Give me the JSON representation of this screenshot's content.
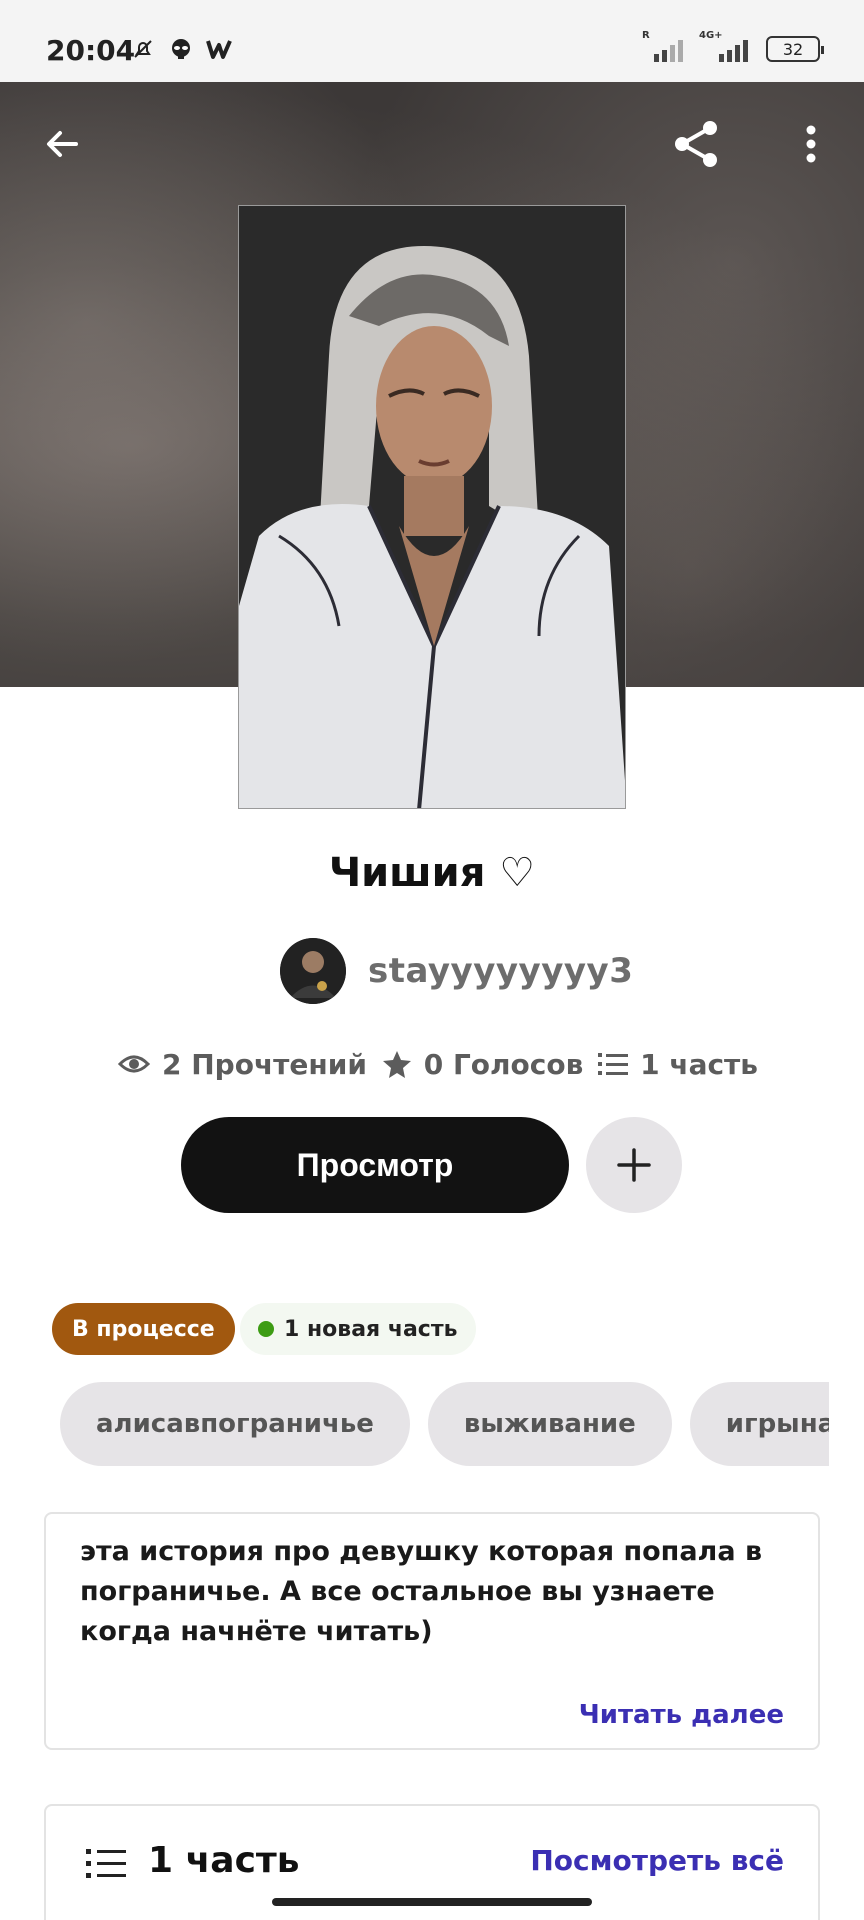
{
  "status_bar": {
    "time": "20:04",
    "battery": "32",
    "signal_1_label": "R",
    "signal_2_label": "4G+"
  },
  "story": {
    "title": "Чишия ♡",
    "author": "stayyyyyyyy3",
    "stats": {
      "reads": "2 Прочтений",
      "votes": "0 Голосов",
      "parts": "1 часть"
    }
  },
  "actions": {
    "read_label": "Просмотр"
  },
  "chips": {
    "status": "В процессе",
    "new_parts": "1 новая часть"
  },
  "tags": [
    "алисавпограничье",
    "выживание",
    "игрынаж"
  ],
  "description": {
    "text": "эта история про девушку которая попала в пограничье. А все остальное вы узнаете когда начнёте читать)",
    "read_more": "Читать далее"
  },
  "parts_section": {
    "title": "1 часть",
    "view_all": "Посмотреть всё"
  },
  "colors": {
    "accent": "#3b2fb3",
    "status_chip": "#a1580f",
    "new_dot": "#3d9c14"
  }
}
